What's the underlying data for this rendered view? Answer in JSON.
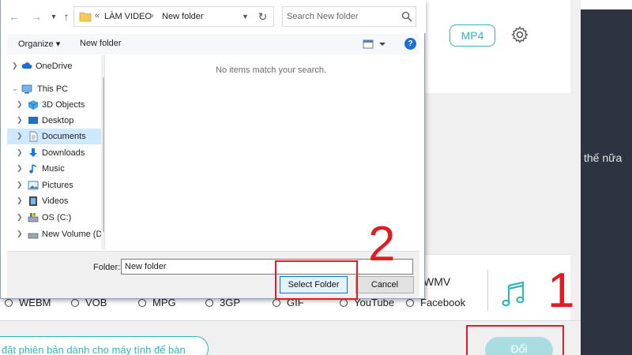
{
  "background_app": {
    "format_button": "MP4",
    "format_options_row1_last": "WMV",
    "format_options": [
      "WEBM",
      "VOB",
      "MPG",
      "3GP",
      "GIF",
      "YouTube",
      "Facebook"
    ],
    "promo_text": "đặt phiên bản dành cho máy tính để bàn",
    "convert_button": "Đổi",
    "side_text": "thế nữa"
  },
  "annotations": {
    "label_1": "1",
    "label_2": "2"
  },
  "dialog": {
    "address": {
      "prefix": "«",
      "segments": [
        "LÀM VIDEO",
        "New folder"
      ],
      "separator": "›"
    },
    "search_placeholder": "Search New folder",
    "toolbar": {
      "organize": "Organize ▾",
      "new_folder": "New folder",
      "help": "?"
    },
    "tree": [
      {
        "label": "OneDrive",
        "icon": "cloud-icon",
        "selected": false
      },
      {
        "label": "This PC",
        "icon": "computer-icon",
        "selected": false
      },
      {
        "label": "3D Objects",
        "icon": "cube-icon",
        "selected": false
      },
      {
        "label": "Desktop",
        "icon": "desktop-icon",
        "selected": false
      },
      {
        "label": "Documents",
        "icon": "document-icon",
        "selected": true
      },
      {
        "label": "Downloads",
        "icon": "download-icon",
        "selected": false
      },
      {
        "label": "Music",
        "icon": "music-note-icon",
        "selected": false
      },
      {
        "label": "Pictures",
        "icon": "picture-icon",
        "selected": false
      },
      {
        "label": "Videos",
        "icon": "video-icon",
        "selected": false
      },
      {
        "label": "OS (C:)",
        "icon": "drive-icon",
        "selected": false
      },
      {
        "label": "New Volume (D",
        "icon": "drive-icon",
        "selected": false
      }
    ],
    "empty_message": "No items match your search.",
    "folder_label": "Folder:",
    "folder_value": "New folder",
    "select_folder_button": "Select Folder",
    "cancel_button": "Cancel"
  },
  "colors": {
    "accent": "#35b6ba",
    "annotation": "#e31c23",
    "selection": "#cde8ff"
  }
}
